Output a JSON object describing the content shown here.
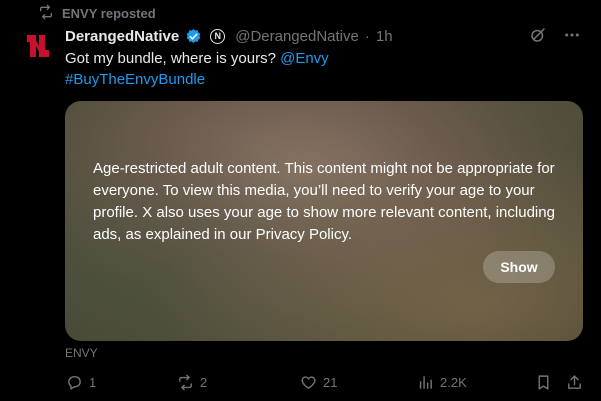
{
  "repost": {
    "label": "ENVY reposted",
    "icon": "repost-icon"
  },
  "author": {
    "display_name": "DerangedNative",
    "affiliate_badge": "N",
    "handle": "@DerangedNative",
    "separator": "·",
    "time": "1h"
  },
  "tweet": {
    "text": "Got my bundle, where is yours? ",
    "mention": "@Envy",
    "hashtag": "#BuyTheEnvyBundle"
  },
  "media": {
    "warning": "Age-restricted adult content. This content might not be appropriate for everyone. To view this media, you’ll need to verify your age to your profile. X also uses your age to show more relevant content, including ads, as explained in our Privacy Policy.",
    "show_label": "Show"
  },
  "source_label": "ENVY",
  "actions": {
    "replies": "1",
    "reposts": "2",
    "likes": "21",
    "views": "2.2K"
  },
  "colors": {
    "background": "#000000",
    "text": "#e7e9ea",
    "muted": "#71767b",
    "link": "#1d9bf0",
    "verified": "#1d9bf0",
    "avatar_red": "#c8102e"
  }
}
